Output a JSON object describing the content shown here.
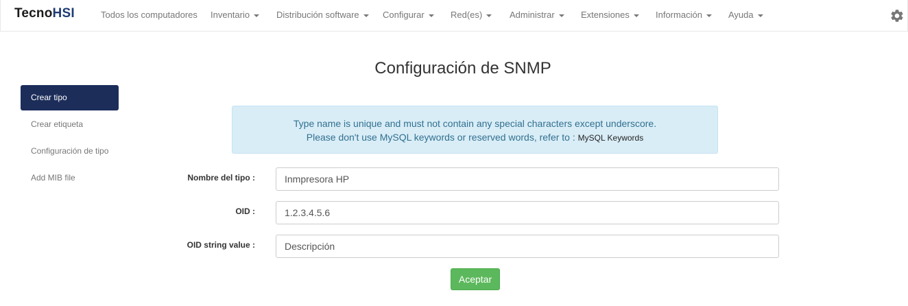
{
  "brand": {
    "part1": "Tecno",
    "part2": "HSI"
  },
  "nav": [
    {
      "label": "Todos los computadores",
      "dropdown": false
    },
    {
      "label": "Inventario",
      "dropdown": true
    },
    {
      "label": "Distribución software",
      "dropdown": true
    },
    {
      "label": "Configurar",
      "dropdown": true
    },
    {
      "label": "Red(es)",
      "dropdown": true
    },
    {
      "label": "Administrar",
      "dropdown": true
    },
    {
      "label": "Extensiones",
      "dropdown": true
    },
    {
      "label": "Información",
      "dropdown": true
    },
    {
      "label": "Ayuda",
      "dropdown": true
    }
  ],
  "settings_icon": "gear-icon",
  "page": {
    "title": "Configuración de SNMP"
  },
  "sidebar": {
    "items": [
      {
        "label": "Crear tipo",
        "active": true
      },
      {
        "label": "Crear etiqueta",
        "active": false
      },
      {
        "label": "Configuración de tipo",
        "active": false
      },
      {
        "label": "Add MIB file",
        "active": false
      }
    ]
  },
  "alert": {
    "line1": "Type name is unique and must not contain any special characters except underscore.",
    "line2": "Please don't use MySQL keywords or reserved words, refer to : ",
    "link": "MySQL Keywords"
  },
  "form": {
    "type_name": {
      "label": "Nombre del tipo :",
      "value": "Inmpresora HP"
    },
    "oid": {
      "label": "OID :",
      "value": "1.2.3.4.5.6"
    },
    "oid_string": {
      "label": "OID string value :",
      "value": "Descripción"
    },
    "submit": "Aceptar"
  },
  "colors": {
    "accent": "#1c2d5a",
    "alert_bg": "#d9edf7",
    "alert_text": "#31708f",
    "success": "#5cb85c"
  }
}
